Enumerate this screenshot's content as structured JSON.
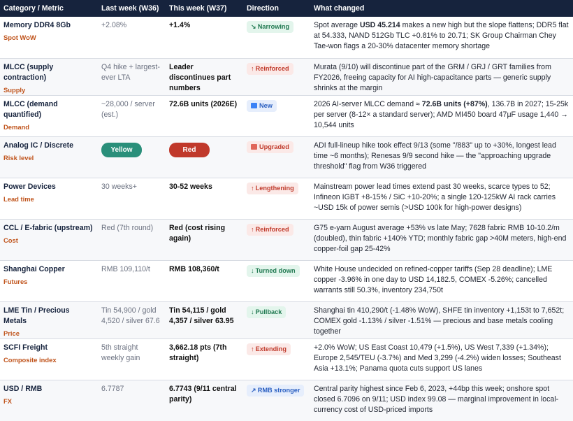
{
  "header": {
    "category": "Category / Metric",
    "last_week": "Last week (W36)",
    "this_week": "This week (W37)",
    "direction": "Direction",
    "what_changed": "What changed"
  },
  "colors": {
    "header_bg": "#16233d",
    "sub_label": "#c0541c",
    "green": "#227a52",
    "red": "#c03a2b",
    "blue": "#2a5fc1"
  },
  "rows": [
    {
      "name": "Memory DDR4 8Gb",
      "sub": "Spot WoW",
      "last": "+2.08%",
      "this": "+1.4%",
      "dir_icon": "↘",
      "dir_label": "Narrowing",
      "what_pre": "Spot average ",
      "what_bold": "USD 45.214",
      "what_post": " makes a new high but the slope flattens; DDR5 flat at 54.333, NAND 512Gb TLC +0.81% to 20.71; SK Group Chairman Chey Tae-won flags a 20-30% datacenter memory shortage"
    },
    {
      "name": "MLCC (supply contraction)",
      "sub": "Supply",
      "last": "Q4 hike + largest-ever LTA",
      "this": "Leader discontinues part numbers",
      "dir_icon": "↑",
      "dir_label": "Reinforced",
      "what_pre": "Murata (9/10) will discontinue part of the GRM / GRJ / GRT families from FY2026, freeing capacity for AI high-capacitance parts — generic supply shrinks at the margin",
      "what_bold": "",
      "what_post": ""
    },
    {
      "name": "MLCC (demand quantified)",
      "sub": "Demand",
      "last": "~28,000 / server (est.)",
      "this": "72.6B units (2026E)",
      "dir_icon": "new-icon",
      "dir_label": "New",
      "what_pre": "2026 AI-server MLCC demand ≈ ",
      "what_bold": "72.6B units (+87%)",
      "what_post": ", 136.7B in 2027; 15-25k per server (8-12× a standard server); AMD MI450 board 47μF usage 1,440 → 10,544 units"
    },
    {
      "name": "Analog IC / Discrete",
      "sub": "Risk level",
      "last_pill": "Yellow",
      "this_pill": "Red",
      "dir_icon": "upgrade-icon",
      "dir_label": "Upgraded",
      "what_pre": "ADI full-lineup hike took effect 9/13 (some \"/883\" up to +30%, longest lead time ~6 months); Renesas 9/9 second hike — the \"approaching upgrade threshold\" flag from W36 triggered",
      "what_bold": "",
      "what_post": ""
    },
    {
      "name": "Power Devices",
      "sub": "Lead time",
      "last": "30 weeks+",
      "this": "30-52 weeks",
      "dir_icon": "↑",
      "dir_label": "Lengthening",
      "what_pre": "Mainstream power lead times extend past 30 weeks, scarce types to 52; Infineon IGBT +8-15% / SiC +10-20%; a single 120-125kW AI rack carries ~USD 15k of power semis (>USD 100k for high-power designs)",
      "what_bold": "",
      "what_post": ""
    },
    {
      "name": "CCL / E-fabric (upstream)",
      "sub": "Cost",
      "last": "Red (7th round)",
      "this": "Red (cost rising again)",
      "dir_icon": "↑",
      "dir_label": "Reinforced",
      "what_pre": "G75 e-yarn August average +53% vs late May; 7628 fabric RMB 10-10.2/m (doubled), thin fabric +140% YTD; monthly fabric gap >40M meters, high-end copper-foil gap 25-42%",
      "what_bold": "",
      "what_post": ""
    },
    {
      "name": "Shanghai Copper",
      "sub": "Futures",
      "last": "RMB 109,110/t",
      "this": "RMB 108,360/t",
      "dir_icon": "↓",
      "dir_label": "Turned down",
      "what_pre": "White House undecided on refined-copper tariffs (Sep 28 deadline); LME copper -3.96% in one day to USD 14,182.5, COMEX -5.26%; cancelled warrants still 50.3%, inventory 234,750t",
      "what_bold": "",
      "what_post": ""
    },
    {
      "name": "LME Tin / Precious Metals",
      "sub": "Price",
      "last": "Tin 54,900 / gold 4,520 / silver 67.6",
      "this": "Tin 54,115 / gold 4,357 / silver 63.95",
      "dir_icon": "↓",
      "dir_label": "Pullback",
      "what_pre": "Shanghai tin 410,290/t (-1.48% WoW), SHFE tin inventory +1,153t to 7,652t; COMEX gold -1.13% / silver -1.51% — precious and base metals cooling together",
      "what_bold": "",
      "what_post": ""
    },
    {
      "name": "SCFI Freight",
      "sub": "Composite index",
      "last": "5th straight weekly gain",
      "this": "3,662.18 pts (7th straight)",
      "dir_icon": "↑",
      "dir_label": "Extending",
      "what_pre": "+2.0% WoW; US East Coast 10,479 (+1.5%), US West 7,339 (+1.34%); Europe 2,545/TEU (-3.7%) and Med 3,299 (-4.2%) widen losses; Southeast Asia +13.1%; Panama quota cuts support US lanes",
      "what_bold": "",
      "what_post": ""
    },
    {
      "name": "USD / RMB",
      "sub": "FX",
      "last": "6.7787",
      "this": "6.7743 (9/11 central parity)",
      "dir_icon": "↗",
      "dir_label": "RMB stronger",
      "what_pre": "Central parity highest since Feb 6, 2023, +44bp this week; onshore spot closed 6.7096 on 9/11; USD index 99.08 — marginal improvement in local-currency cost of USD-priced imports",
      "what_bold": "",
      "what_post": ""
    }
  ]
}
